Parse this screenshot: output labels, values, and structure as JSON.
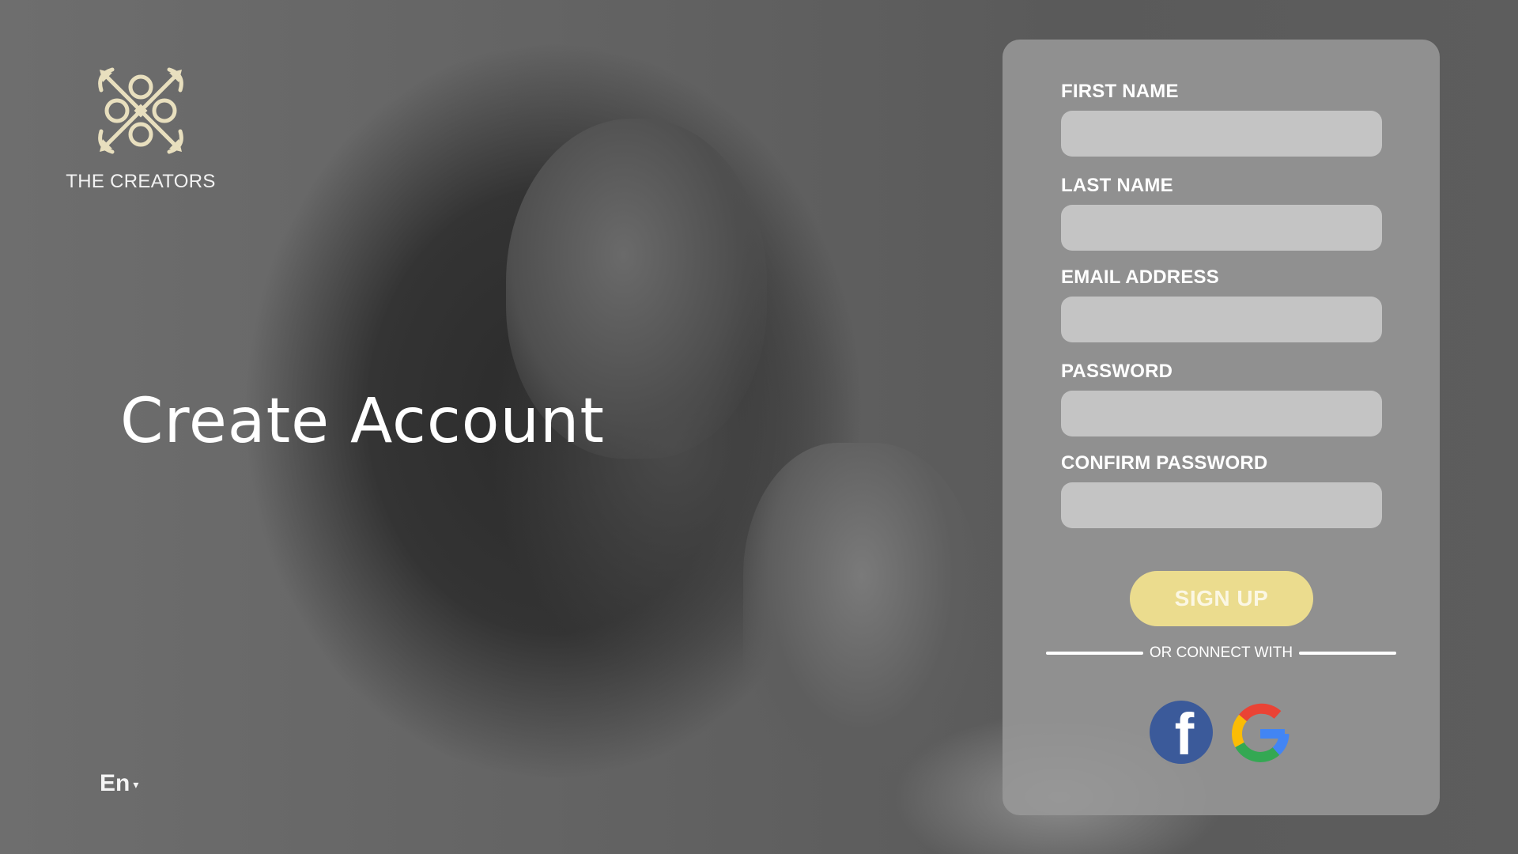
{
  "brand": {
    "name": "THE CREATORS",
    "logo_icon": "ornamental-crossed-logo-icon",
    "logo_color": "#e8dfbe"
  },
  "hero": {
    "headline": "Create Account"
  },
  "language": {
    "selected": "En",
    "caret": "▾"
  },
  "form": {
    "fields": [
      {
        "label": "FIRST NAME",
        "value": "",
        "placeholder": ""
      },
      {
        "label": "LAST NAME",
        "value": "",
        "placeholder": ""
      },
      {
        "label": "EMAIL ADDRESS",
        "value": "",
        "placeholder": ""
      },
      {
        "label": "PASSWORD",
        "value": "",
        "placeholder": ""
      },
      {
        "label": "CONFIRM PASSWORD",
        "value": "",
        "placeholder": ""
      }
    ],
    "submit_label": "SIGN UP",
    "divider_text": "OR CONNECT WITH",
    "social": [
      {
        "name": "facebook",
        "icon": "facebook-icon",
        "glyph": "f",
        "color": "#3b5a9a"
      },
      {
        "name": "google",
        "icon": "google-icon",
        "colors": [
          "#ea4335",
          "#fbbc05",
          "#34a853",
          "#4285f4"
        ]
      }
    ]
  },
  "colors": {
    "panel": "#989898",
    "input": "#c4c4c4",
    "button": "#ebdc8e",
    "text": "#ffffff"
  }
}
